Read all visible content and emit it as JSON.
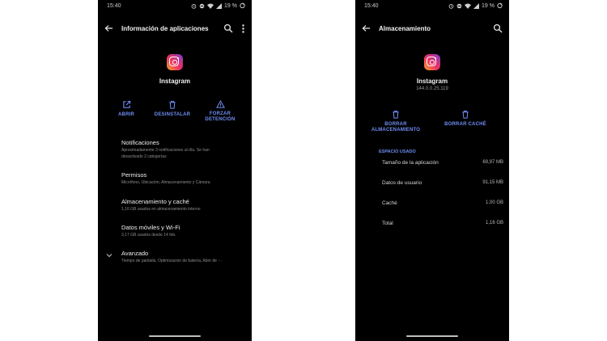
{
  "left_screen": {
    "status": {
      "time": "15:40",
      "battery": "19 %"
    },
    "app_bar": {
      "title": "Información de aplicaciones"
    },
    "app": {
      "name": "Instagram"
    },
    "actions": {
      "open": "ABRIR",
      "uninstall": "DESINSTALAR",
      "force_stop_line1": "FORZAR",
      "force_stop_line2": "DETENCIÓN"
    },
    "items": [
      {
        "title": "Notificaciones",
        "sub1": "Aproximadamente 3 notificaciones al día. Se han",
        "sub2": "desactivado 2 categorías"
      },
      {
        "title": "Permisos",
        "sub1": "Micrófono, Ubicación, Almacenamiento y Cámara"
      },
      {
        "title": "Almacenamiento y caché",
        "sub1": "1,16 GB usados en almacenamiento interno"
      },
      {
        "title": "Datos móviles y Wi-Fi",
        "sub1": "3,17 GB usados desde 14 feb."
      },
      {
        "title": "Avanzado",
        "sub1": "Tiempo de pantalla, Optimización de batería, Abrir de ···"
      }
    ]
  },
  "right_screen": {
    "status": {
      "time": "15:40",
      "battery": "19 %"
    },
    "app_bar": {
      "title": "Almacenamiento"
    },
    "app": {
      "name": "Instagram",
      "version": "144.0.0.25.119"
    },
    "actions": {
      "clear_storage_line1": "BORRAR",
      "clear_storage_line2": "ALMACENAMIENTO",
      "clear_cache": "BORRAR CACHÉ"
    },
    "section_header": "ESPACIO USADO",
    "rows": [
      {
        "label": "Tamaño de la aplicación",
        "value": "69,97 MB"
      },
      {
        "label": "Datos de usuario",
        "value": "91,15 MB"
      },
      {
        "label": "Caché",
        "value": "1,00 GB"
      },
      {
        "label": "Total",
        "value": "1,16 GB"
      }
    ]
  },
  "colors": {
    "background": "#000000",
    "accent": "#6f8ef5",
    "page": "#ffffff"
  }
}
